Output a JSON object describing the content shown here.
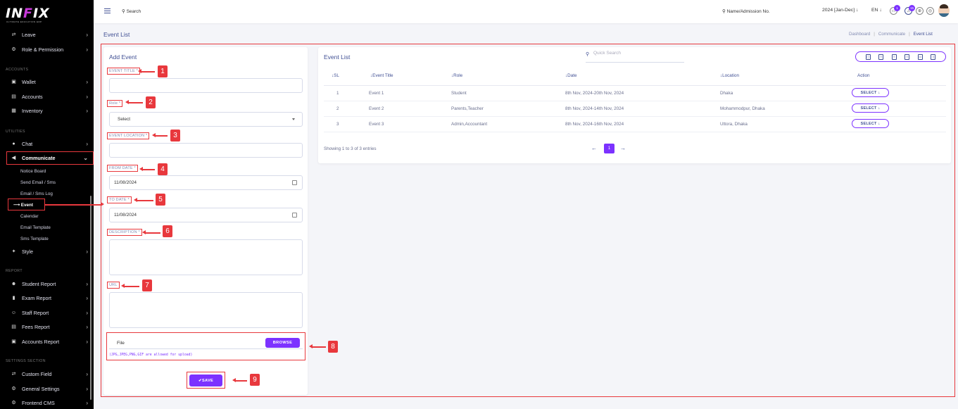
{
  "brand": {
    "logo_main": "INFIX",
    "logo_sub": "ULTIMATE EDUCATION ERP"
  },
  "sidebar": {
    "items_top": [
      {
        "label": "Leave",
        "icon": "leave-icon"
      },
      {
        "label": "Role & Permission",
        "icon": "role-icon"
      }
    ],
    "section_accounts": "ACCOUNTS",
    "items_accounts": [
      {
        "label": "Wallet",
        "icon": "wallet-icon"
      },
      {
        "label": "Accounts",
        "icon": "accounts-icon"
      },
      {
        "label": "Inventory",
        "icon": "inventory-icon"
      }
    ],
    "section_utilities": "UTILITIES",
    "chat_label": "Chat",
    "communicate_label": "Communicate",
    "communicate_subs": [
      "Notice Board",
      "Send Email / Sms",
      "Email / Sms Log",
      "Event",
      "Calendar",
      "Email Template",
      "Sms Template"
    ],
    "style_label": "Style",
    "section_report": "REPORT",
    "items_report": [
      {
        "label": "Student Report",
        "icon": "student-report-icon"
      },
      {
        "label": "Exam Report",
        "icon": "exam-report-icon"
      },
      {
        "label": "Staff Report",
        "icon": "staff-report-icon"
      },
      {
        "label": "Fees Report",
        "icon": "fees-report-icon"
      },
      {
        "label": "Accounts Report",
        "icon": "accounts-report-icon"
      }
    ],
    "section_settings": "SETTINGS SECTION",
    "items_settings": [
      {
        "label": "Custom Field",
        "icon": "custom-field-icon"
      },
      {
        "label": "General Settings",
        "icon": "general-settings-icon"
      },
      {
        "label": "Frontend CMS",
        "icon": "frontend-cms-icon"
      }
    ]
  },
  "header": {
    "search_label": "Search",
    "admission_search": "Name/Admission No.",
    "session": "2024 [Jan-Dec]",
    "language": "EN",
    "chat_badge": "1",
    "notification_badge": "15"
  },
  "page": {
    "title": "Event List",
    "breadcrumb": [
      "Dashboard",
      "Communicate",
      "Event List"
    ]
  },
  "form": {
    "title": "Add Event",
    "event_title_label": "EVENT TITLE *",
    "role_label": "Role *",
    "role_value": "Select",
    "location_label": "EVENT LOCATION *",
    "from_date_label": "FROM DATE *",
    "from_date_value": "11/08/2024",
    "to_date_label": "TO DATE *",
    "to_date_value": "11/08/2024",
    "description_label": "DESCRIPTION *",
    "url_label": "URL",
    "file_label": "File",
    "browse_label": "BROWSE",
    "file_note": "(JPG,JPEG,PNG,GIF are allowed for upload)",
    "save_label": "SAVE"
  },
  "callouts": [
    "1",
    "2",
    "3",
    "4",
    "5",
    "6",
    "7",
    "8",
    "9"
  ],
  "list": {
    "title": "Event List",
    "quick_search_placeholder": "Quick Search",
    "columns": [
      "SL",
      "Event Title",
      "Role",
      "Date",
      "Location",
      "Action"
    ],
    "rows": [
      {
        "sl": "1",
        "title": "Event 1",
        "role": "Student",
        "date": "8th Nov, 2024-20th Nov, 2024",
        "location": "Dhaka",
        "action": "SELECT"
      },
      {
        "sl": "2",
        "title": "Event 2",
        "role": "Parents,Teacher",
        "date": "8th Nov, 2024-14th Nov, 2024",
        "location": "Mohammodpur, Dhaka",
        "action": "SELECT"
      },
      {
        "sl": "3",
        "title": "Event 3",
        "role": "Admin,Accountant",
        "date": "8th Nov, 2024-16th Nov, 2024",
        "location": "Uttora, Dhaka",
        "action": "SELECT"
      }
    ],
    "showing": "Showing 1 to 3 of 3 entries",
    "current_page": "1"
  },
  "colors": {
    "accent": "#7c32ff",
    "annotation": "#e8383d",
    "text": "#415094"
  }
}
